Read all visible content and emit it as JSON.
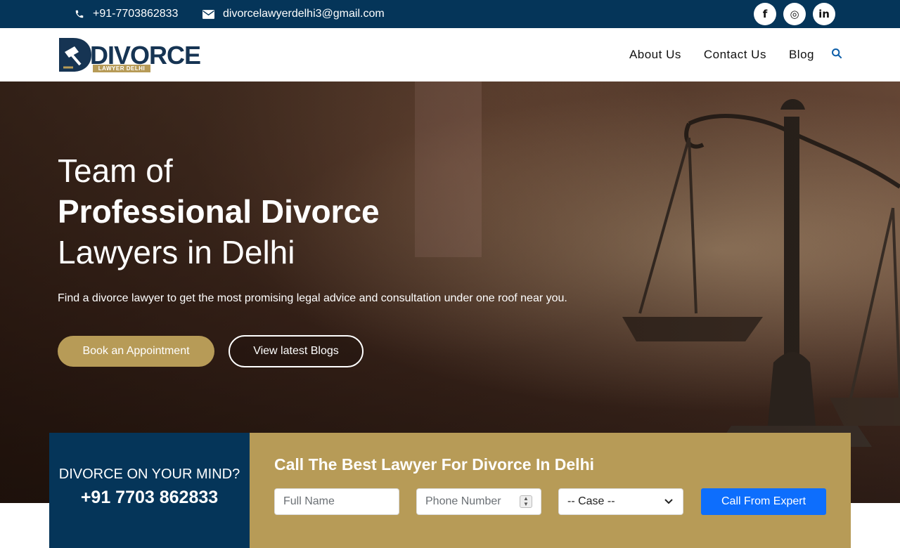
{
  "topbar": {
    "phone": "+91-7703862833",
    "email": "divorcelawyerdelhi3@gmail.com",
    "social": [
      {
        "icon": "facebook-icon",
        "glyph": "f"
      },
      {
        "icon": "instagram-icon",
        "glyph": "◎"
      },
      {
        "icon": "linkedin-icon",
        "glyph": "in"
      }
    ]
  },
  "header": {
    "logo_word": "DIVORCE",
    "logo_sub": "LAWYER DELHI",
    "nav": [
      "About Us",
      "Contact Us",
      "Blog"
    ],
    "search_icon": "search-icon"
  },
  "hero": {
    "line1": "Team of",
    "line2": "Professional Divorce",
    "line3": "Lawyers in Delhi",
    "subtitle": "Find a divorce lawyer to get the most promising legal advice and consultation under one roof near you.",
    "btn_book": "Book an Appointment",
    "btn_blogs": "View latest Blogs"
  },
  "cta": {
    "question": "DIVORCE ON YOUR MIND?",
    "number": "+91 7703 862833",
    "title": "Call The Best Lawyer For Divorce In Delhi",
    "name_placeholder": "Full Name",
    "phone_placeholder": "Phone Number",
    "case_selected": "-- Case --",
    "submit": "Call From Expert"
  },
  "colors": {
    "navy": "#053559",
    "gold": "#b79b57",
    "blue": "#0d6efd"
  }
}
